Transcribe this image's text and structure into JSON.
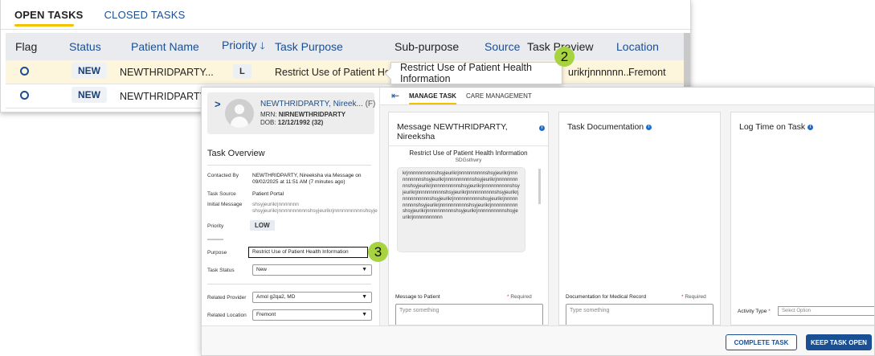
{
  "task_list": {
    "tabs": [
      "OPEN TASKS",
      "CLOSED TASKS"
    ],
    "columns": {
      "flag": "Flag",
      "status": "Status",
      "patient_name": "Patient Name",
      "priority": "Priority",
      "sort_arrow": "🡓",
      "task_purpose": "Task Purpose",
      "sub_purpose": "Sub-purpose",
      "source": "Source",
      "task_preview": "Task Preview",
      "location": "Location"
    },
    "rows": [
      {
        "status": "NEW",
        "patient_name": "NEWTHRIDPARTY...",
        "priority": "L",
        "task_purpose": "Restrict Use of Patient Heal...",
        "task_preview": "urikrjnnnnnn...",
        "location": "Fremont"
      },
      {
        "status": "NEW",
        "patient_name": "NEWTHRIDPARTY"
      }
    ],
    "tooltip": "Restrict Use of Patient Health Information"
  },
  "steps": {
    "two": "2",
    "three": "3"
  },
  "patient": {
    "chevron": ">",
    "name": "NEWTHRIDPARTY, Nireek...",
    "sex": "(F)",
    "mrn_label": "MRN:",
    "mrn": "NIRNEWTHRIDPARTY",
    "dob_label": "DOB:",
    "dob": "12/12/1992 (32)"
  },
  "overview": {
    "title": "Task Overview",
    "contacted_by_label": "Contacted By",
    "contacted_by_line1": "NEWTHRIDPARTY, Nireeksha via Message on",
    "contacted_by_line2": "09/02/2025 at 11:51 AM (7 minutes ago)",
    "source_label": "Task Source",
    "source": "Patient Portal",
    "initial_message_label": "Initial Message",
    "initial_message_line1": "shsyjeurikrjnnnnnnn",
    "initial_message_line2": "shsyjeurikrjnnnnnnnnnnshsyjeurikrjnnnnnnnnnnshsyje",
    "priority_label": "Priority",
    "priority": "LOW",
    "purpose_label": "Purpose",
    "purpose": "Restrict Use of Patient Health Information",
    "task_status_label": "Task Status",
    "task_status": "New",
    "related_provider_label": "Related Provider",
    "related_provider": "Amol g2qa2, MD",
    "related_location_label": "Related Location",
    "related_location": "Fremont"
  },
  "detail_tabs": [
    "MANAGE TASK",
    "CARE MANAGEMENT"
  ],
  "message_card": {
    "title_line1": "Message NEWTHRIDPARTY,",
    "title_line2": "Nireeksha",
    "subject": "Restrict Use of Patient Health Information",
    "subpurpose": "SDGsthwry",
    "body": "krjnnnnnnnnnnshsyjeurikrjnnnnnnnnnnshsyjeurikrjnnnnnnnnnnshsyjeurikrjnnnnnnnnnnshsyjeurikrjnnnnnnnnnnshsyjeurikrjnnnnnnnnnnshsyjeurikrjnnnnnnnnnnshsyjeurikrjnnnnnnnnnnshsyjeurikrjnnnnnnnnnnshsyjeurikrjnnnnnnnnnnshsyjeurikrjnnnnnnnnnnshsyjeurikrjnnnnnnnnnnshsyjeurikrjnnnnnnnnnnshsyjeurikrjnnnnnnnnnnshsyjeurikrjnnnnnnnnnnshsyjeurikrjnnnnnnnnnnshsyjeurikrjnnnnnnnnnnn",
    "reply_label": "Message to Patient",
    "required": "Required",
    "placeholder": "Type something"
  },
  "documentation_card": {
    "title": "Task Documentation",
    "field_label": "Documentation for Medical Record",
    "required": "Required",
    "placeholder": "Type something"
  },
  "log_time_card": {
    "title": "Log Time on Task",
    "activity_label": "Activity Type",
    "activity_placeholder": "Select Option"
  },
  "buttons": {
    "complete": "COMPLETE TASK",
    "keep_open": "KEEP TASK OPEN"
  },
  "colors": {
    "brand_blue": "#1b4f93",
    "accent_yellow": "#f2c200",
    "step_green": "#a6d33f",
    "row_highlight": "#fdf5dc"
  }
}
